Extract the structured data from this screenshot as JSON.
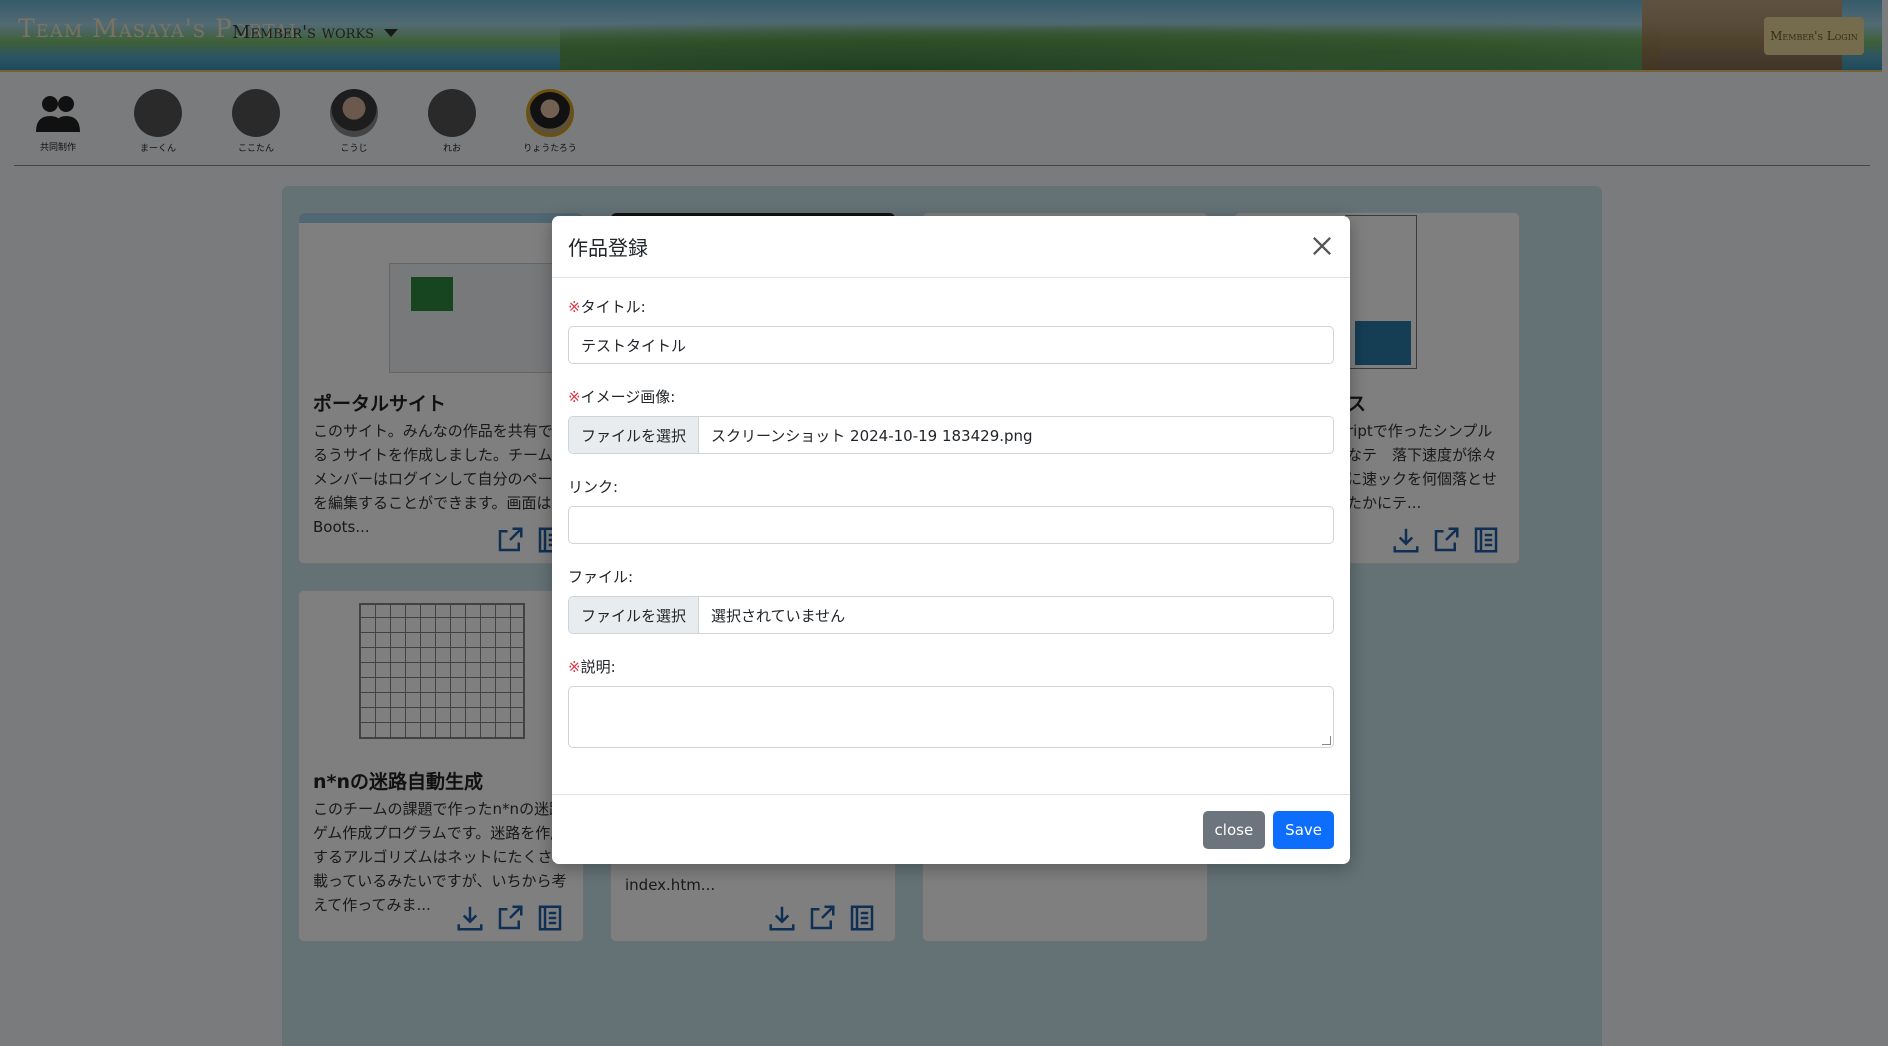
{
  "header": {
    "brand": "Team Masaya's Portal",
    "nav_works": "Member's works",
    "login": "Member's Login"
  },
  "members": [
    {
      "name": "共同制作",
      "icon": "group-icon"
    },
    {
      "name": "まーくん",
      "icon": "avatar"
    },
    {
      "name": "ここたん",
      "icon": "avatar"
    },
    {
      "name": "こうじ",
      "icon": "avatar-photo"
    },
    {
      "name": "れお",
      "icon": "avatar"
    },
    {
      "name": "りょうたろう",
      "icon": "avatar-photo"
    }
  ],
  "cards": [
    {
      "title": "ポータルサイト",
      "desc": "このサイト。みんなの作品を共有できるうサイトを作成しました。チームのメンバーはログインして自分のページを編集することができます。画面はBoots..."
    },
    {
      "title": "ス",
      "desc": "riptで作ったシンプルなテ　落下速度が徐々に速ックを何個落とせたかにテ..."
    },
    {
      "title": "n*nの迷路自動生成",
      "desc": "このチームの課題で作ったn*nの迷路ゲム作成プログラムです。迷路を作成するアルゴリズムはネットにたくさん載っているみたいですが、いちから考えて作ってみま..."
    },
    {
      "title": "",
      "desc": "index.htm..."
    }
  ],
  "modal": {
    "title": "作品登録",
    "required_mark": "※",
    "fields": {
      "title_label": "タイトル:",
      "title_value": "テストタイトル",
      "image_label": "イメージ画像:",
      "image_button": "ファイルを選択",
      "image_file": "スクリーンショット 2024-10-19 183429.png",
      "link_label": "リンク:",
      "link_value": "",
      "file_label": "ファイル:",
      "file_button": "ファイルを選択",
      "file_name": "選択されていません",
      "desc_label": "説明:"
    },
    "close_label": "close",
    "save_label": "Save"
  },
  "colors": {
    "primary": "#0d6efd",
    "secondary": "#6c757d",
    "required": "#dc3545",
    "icon": "#1f5fa8"
  }
}
